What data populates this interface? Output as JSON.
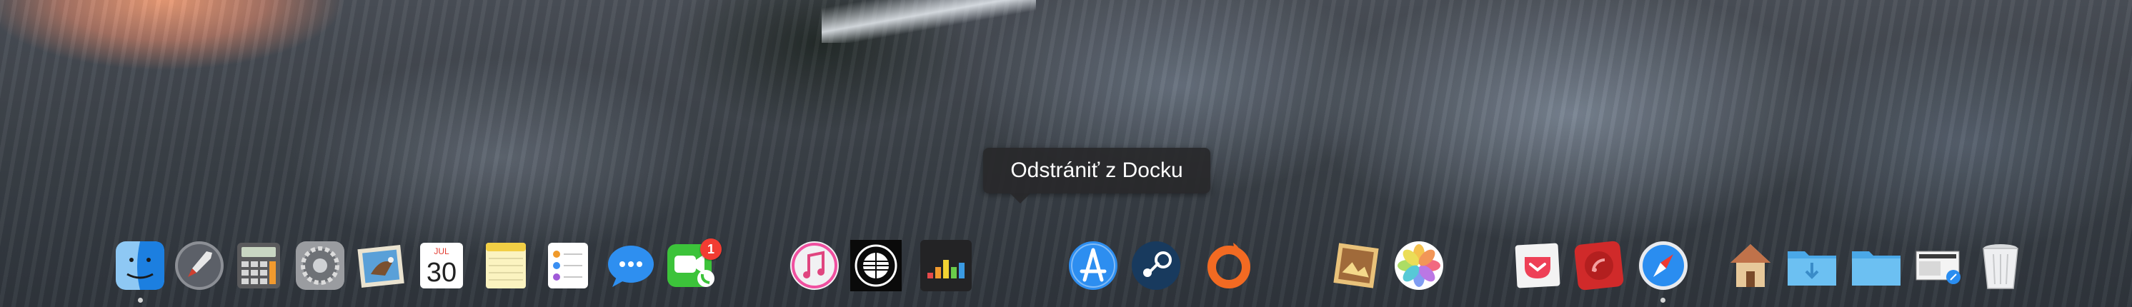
{
  "tooltip": {
    "text": "Odstrániť z Docku"
  },
  "dock": {
    "items": [
      {
        "name": "Finder",
        "icon": "finder-icon"
      },
      {
        "name": "Launchpad",
        "icon": "launchpad-icon"
      },
      {
        "name": "Calculator",
        "icon": "calculator-icon"
      },
      {
        "name": "System Preferences",
        "icon": "system-preferences-icon"
      },
      {
        "name": "Mail",
        "icon": "mail-icon"
      },
      {
        "name": "Calendar",
        "icon": "calendar-icon",
        "month": "JUL",
        "day": "30"
      },
      {
        "name": "Notes",
        "icon": "notes-icon"
      },
      {
        "name": "Reminders",
        "icon": "reminders-icon"
      },
      {
        "name": "Messages",
        "icon": "messages-icon"
      },
      {
        "name": "FaceTime",
        "icon": "facetime-icon",
        "badge": "1"
      },
      {
        "name": "iTunes",
        "icon": "itunes-icon"
      },
      {
        "name": "Ministry of Sound",
        "icon": "ministry-of-sound-icon"
      },
      {
        "name": "Deezer",
        "icon": "deezer-icon"
      },
      {
        "name": "App Store",
        "icon": "app-store-icon"
      },
      {
        "name": "Steam",
        "icon": "steam-icon"
      },
      {
        "name": "Origin",
        "icon": "origin-icon"
      },
      {
        "name": "Preview",
        "icon": "preview-icon"
      },
      {
        "name": "Photos",
        "icon": "photos-icon"
      },
      {
        "name": "Pocket",
        "icon": "pocket-icon"
      },
      {
        "name": "Reeder",
        "icon": "rss-reader-icon"
      },
      {
        "name": "Safari",
        "icon": "safari-icon"
      },
      {
        "name": "Home",
        "icon": "home-folder-icon"
      },
      {
        "name": "Downloads",
        "icon": "downloads-folder-icon"
      },
      {
        "name": "Documents",
        "icon": "folder-icon"
      },
      {
        "name": "Screenshot",
        "icon": "screenshot-icon"
      },
      {
        "name": "Trash",
        "icon": "trash-icon"
      }
    ]
  }
}
